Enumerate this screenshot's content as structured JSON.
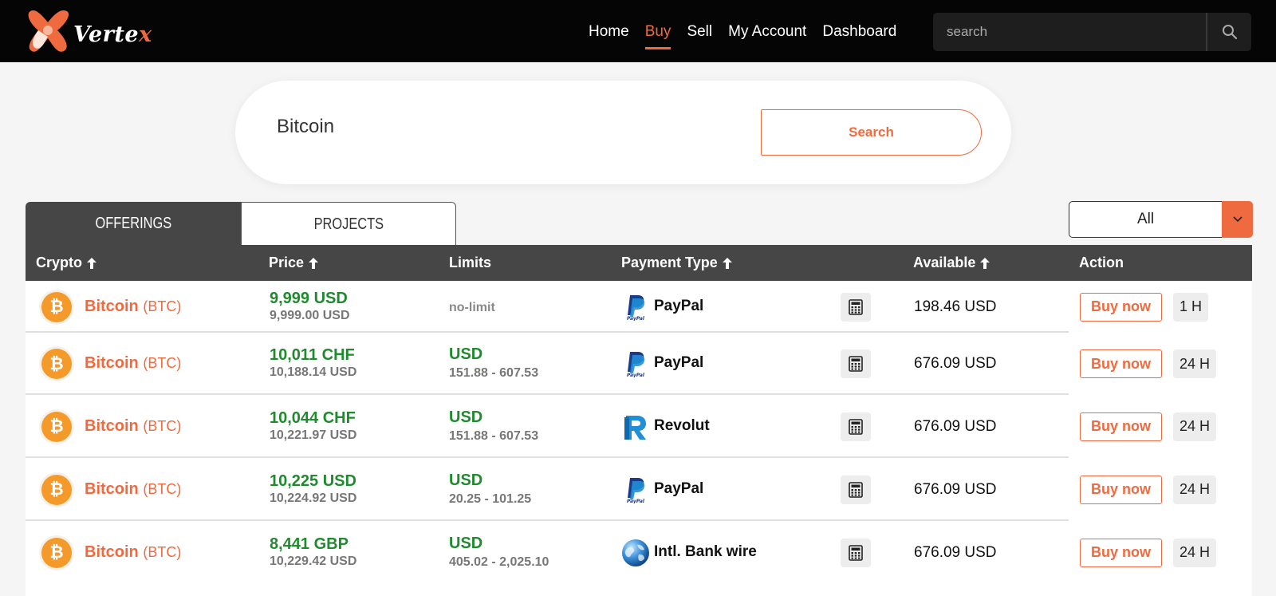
{
  "header": {
    "logo_text": "Verte",
    "logo_text_x": "x",
    "nav": [
      {
        "label": "Home",
        "active": false
      },
      {
        "label": "Buy",
        "active": true
      },
      {
        "label": "Sell",
        "active": false
      },
      {
        "label": "My Account",
        "active": false
      },
      {
        "label": "Dashboard",
        "active": false
      }
    ],
    "search_placeholder": "search"
  },
  "hero_search": {
    "value": "Bitcoin",
    "button_label": "Search"
  },
  "tabs": [
    {
      "label": "OFFERINGS",
      "active": true
    },
    {
      "label": "PROJECTS",
      "active": false
    }
  ],
  "filter": {
    "selected": "All"
  },
  "table": {
    "columns": {
      "crypto": "Crypto",
      "price": "Price",
      "limits": "Limits",
      "payment": "Payment Type",
      "available": "Available",
      "action": "Action"
    },
    "rows": [
      {
        "coin": "Bitcoin",
        "symbol": "(BTC)",
        "price": "9,999 USD",
        "price_sub": "9,999.00 USD",
        "limit_currency": "",
        "limit_range": "no-limit",
        "payment": "PayPal",
        "payment_icon": "paypal-icon",
        "available": "198.46 USD",
        "buy_label": "Buy now",
        "time": "1 H"
      },
      {
        "coin": "Bitcoin",
        "symbol": "(BTC)",
        "price": "10,011 CHF",
        "price_sub": "10,188.14 USD",
        "limit_currency": "USD",
        "limit_range": "151.88 - 607.53",
        "payment": "PayPal",
        "payment_icon": "paypal-icon",
        "available": "676.09 USD",
        "buy_label": "Buy now",
        "time": "24 H"
      },
      {
        "coin": "Bitcoin",
        "symbol": "(BTC)",
        "price": "10,044 CHF",
        "price_sub": "10,221.97 USD",
        "limit_currency": "USD",
        "limit_range": "151.88 - 607.53",
        "payment": "Revolut",
        "payment_icon": "revolut-icon",
        "available": "676.09 USD",
        "buy_label": "Buy now",
        "time": "24 H"
      },
      {
        "coin": "Bitcoin",
        "symbol": "(BTC)",
        "price": "10,225 USD",
        "price_sub": "10,224.92 USD",
        "limit_currency": "USD",
        "limit_range": "20.25 - 101.25",
        "payment": "PayPal",
        "payment_icon": "paypal-icon",
        "available": "676.09 USD",
        "buy_label": "Buy now",
        "time": "24 H"
      },
      {
        "coin": "Bitcoin",
        "symbol": "(BTC)",
        "price": "8,441 GBP",
        "price_sub": "10,229.42 USD",
        "limit_currency": "USD",
        "limit_range": "405.02 - 2,025.10",
        "payment": "Intl. Bank wire",
        "payment_icon": "globe-icon",
        "available": "676.09 USD",
        "buy_label": "Buy now",
        "time": "24 H"
      }
    ]
  },
  "colors": {
    "accent": "#ef6a3f",
    "price_green": "#1f8a2e",
    "header_bg": "#050505",
    "table_header_bg": "#464646"
  }
}
